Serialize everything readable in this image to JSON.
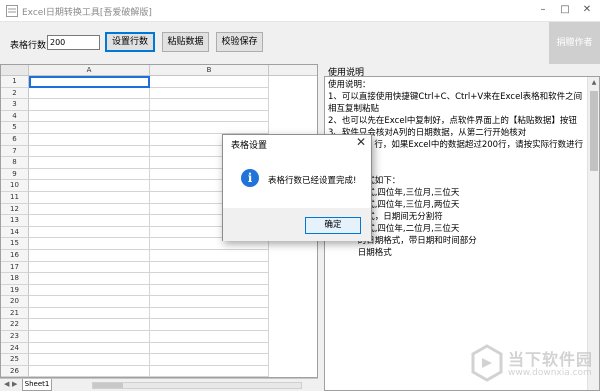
{
  "window": {
    "title": "Excel日期转换工具[吾爱破解版]",
    "minimize": "–",
    "close": "✕",
    "maximize": "□"
  },
  "toolbar": {
    "rows_label": "表格行数",
    "rows_value": "200",
    "set_rows_button": "设置行数",
    "paste_button": "粘贴数据",
    "verify_save_button": "校验保存",
    "author_button": "捐赠作者"
  },
  "grid": {
    "columns": [
      "A",
      "B"
    ],
    "row_numbers": [
      "1",
      "2",
      "3",
      "4",
      "5",
      "6",
      "7",
      "8",
      "9",
      "10",
      "11",
      "12",
      "13",
      "14",
      "15",
      "16",
      "17",
      "18",
      "19",
      "20",
      "21",
      "22",
      "23",
      "24",
      "25",
      "26"
    ],
    "sheet_tab": "Sheet1"
  },
  "instructions": {
    "caption": "使用说明",
    "text": "使用说明：\n1、可以直接使用快捷键Ctrl+C、Ctrl+V来在Excel表格和软件之间相互复制粘贴\n2、也可以先在Excel中复制好，点软件界面上的【粘贴数据】按钮\n3、软件只会核对A列的日期数据，从第二行开始核对\n4、            行，如果Excel中的数据超过200行，请按实际行数进行设\n\n           格式如下：\n           格式,四位年,三位月,三位天\n           格式,四位年,三位月,两位天\n           格式，日期间无分割符\n           格式,四位年,二位月,三位天\n           的日期格式，带日期和时间部分\n           日期格式"
  },
  "dialog": {
    "title": "表格设置",
    "message": "表格行数已经设置完成!",
    "ok_button": "确定",
    "info_glyph": "i",
    "close_glyph": "✕"
  },
  "watermark": {
    "line1": "当下软件园",
    "line2": "www.downxia.com"
  },
  "colors": {
    "accent": "#0078d7",
    "info_icon": "#1f73d9",
    "watermark": "#c8c8c8"
  }
}
